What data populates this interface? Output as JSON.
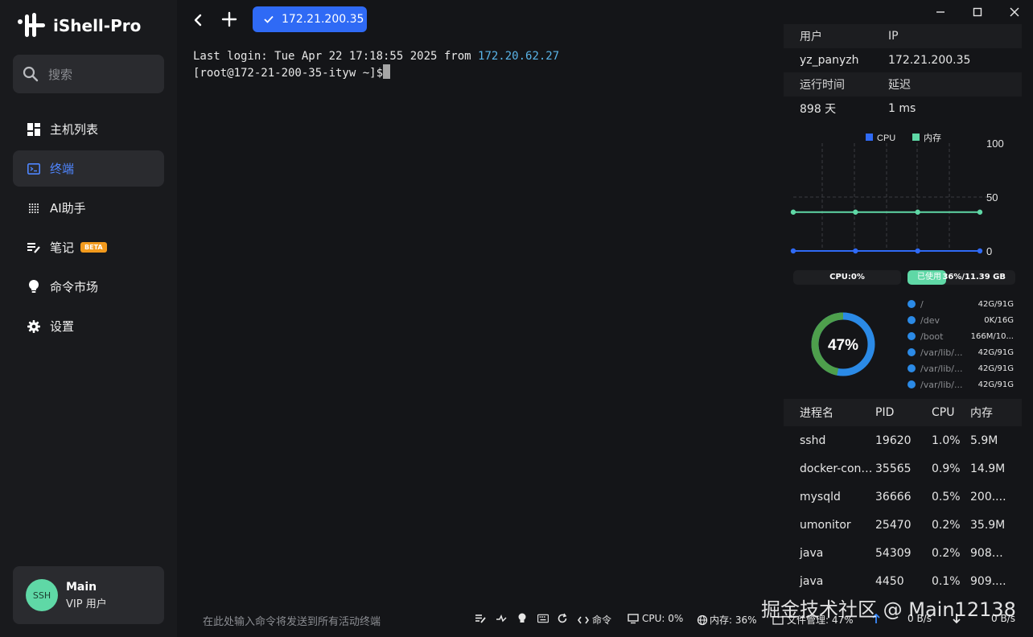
{
  "app": {
    "name": "iShell-Pro"
  },
  "search": {
    "placeholder": "搜索"
  },
  "nav": [
    {
      "label": "主机列表",
      "icon": "dashboard-icon"
    },
    {
      "label": "终端",
      "icon": "terminal-icon",
      "active": true
    },
    {
      "label": "AI助手",
      "icon": "ai-chip-icon"
    },
    {
      "label": "笔记",
      "icon": "notes-icon",
      "badge": "BETA"
    },
    {
      "label": "命令市场",
      "icon": "lightbulb-icon"
    },
    {
      "label": "设置",
      "icon": "gear-icon"
    }
  ],
  "user": {
    "avatar": "SSH",
    "name": "Main",
    "role": "VIP 用户"
  },
  "tab": {
    "label": "172.21.200.35"
  },
  "terminal": {
    "login_prefix": "Last login: Tue Apr 22 17:18:55 2025 from ",
    "login_ip": "172.20.62.27",
    "prompt": "[root@172-21-200-35-ityw ~]$"
  },
  "host_info": {
    "user_label": "用户",
    "ip_label": "IP",
    "user": "yz_panyzh",
    "ip": "172.21.200.35",
    "uptime_label": "运行时间",
    "latency_label": "延迟",
    "uptime": "898 天",
    "latency": "1 ms"
  },
  "chart_data": {
    "type": "line",
    "x": [
      1,
      2,
      3,
      4
    ],
    "series": [
      {
        "name": "CPU",
        "color": "#2f6af5",
        "values": [
          0,
          0,
          0,
          0
        ]
      },
      {
        "name": "内存",
        "color": "#5fd8a6",
        "values": [
          36,
          36,
          36,
          36
        ]
      }
    ],
    "ylim": [
      0,
      100
    ],
    "yticks": [
      "100",
      "50",
      "0"
    ],
    "legend": "top",
    "grid": true
  },
  "stats": {
    "cpu_label": "CPU:0%",
    "mem_used_label": "已使用",
    "mem_value": "36%/11.39 GB",
    "mem_fraction": 0.36,
    "disk_percent_label": "47%",
    "disk_fraction": 0.47
  },
  "disks": [
    {
      "path": "/",
      "value": "42G/91G"
    },
    {
      "path": "/dev",
      "value": "0K/16G"
    },
    {
      "path": "/boot",
      "value": "166M/10..."
    },
    {
      "path": "/var/lib/...",
      "value": "42G/91G"
    },
    {
      "path": "/var/lib/...",
      "value": "42G/91G"
    },
    {
      "path": "/var/lib/...",
      "value": "42G/91G"
    }
  ],
  "processes": {
    "headers": {
      "name": "进程名",
      "pid": "PID",
      "cpu": "CPU",
      "mem": "内存"
    },
    "rows": [
      {
        "name": "sshd",
        "pid": "19620",
        "cpu": "1.0%",
        "mem": "5.9M"
      },
      {
        "name": "docker-cont...",
        "pid": "35565",
        "cpu": "0.9%",
        "mem": "14.9M"
      },
      {
        "name": "mysqld",
        "pid": "36666",
        "cpu": "0.5%",
        "mem": "200...."
      },
      {
        "name": "umonitor",
        "pid": "25470",
        "cpu": "0.2%",
        "mem": "35.9M"
      },
      {
        "name": "java",
        "pid": "54309",
        "cpu": "0.2%",
        "mem": "9085...."
      },
      {
        "name": "java",
        "pid": "4450",
        "cpu": "0.1%",
        "mem": "909...."
      }
    ]
  },
  "status_bar": {
    "broadcast_placeholder": "在此处输入命令将发送到所有活动终端",
    "commands_label": "命令",
    "cpu": "CPU: 0%",
    "mem": "内存: 36%",
    "files": "文件管理: 47%",
    "upload": "0 B/s",
    "download": "0 B/s"
  },
  "watermark": "掘金技术社区 @ Main12138"
}
